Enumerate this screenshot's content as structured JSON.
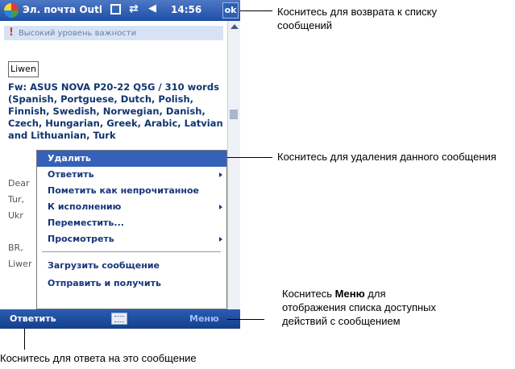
{
  "titlebar": {
    "title": "Эл. почта Outl",
    "time": "14:56",
    "ok_label": "ok"
  },
  "message": {
    "priority_text": "Высокий уровень важности",
    "priority_mark": "!",
    "sender": "Liwen",
    "subject": "Fw: ASUS NOVA P20-22 Q5G / 310 words (Spanish, Portguese, Dutch, Polish, Finnish, Swedish, Norwegian, Danish, Czech, Hungarian, Greek, Arabic, Latvian and Lithuanian, Turk",
    "body_lines": [
      "Dear",
      "Tur,",
      "Ukr",
      "",
      "BR,",
      "Liwer"
    ]
  },
  "context_menu": {
    "items": [
      {
        "label": "Удалить",
        "selected": true,
        "submenu": false
      },
      {
        "label": "Ответить",
        "submenu": true
      },
      {
        "label": "Пометить как непрочитанное",
        "submenu": false
      },
      {
        "label": "К исполнению",
        "submenu": true
      },
      {
        "label": "Переместить...",
        "submenu": false
      },
      {
        "label": "Просмотреть",
        "submenu": true
      },
      {
        "label": "Загрузить сообщение",
        "submenu": false
      },
      {
        "label": "Отправить и получить",
        "submenu": false
      }
    ]
  },
  "bottombar": {
    "reply_label": "Ответить",
    "menu_label": "Меню",
    "keyboard_icon": "keyboard-icon"
  },
  "callouts": {
    "ok": "Коснитесь для возврата к списку сообщений",
    "delete": "Коснитесь для удаления данного сообщения",
    "menu_bold": "Меню",
    "menu_pre": "Коснитесь ",
    "menu_post": " для отображения списка доступных действий с сообщением",
    "reply": "Коснитесь для ответа на это сообщение"
  }
}
